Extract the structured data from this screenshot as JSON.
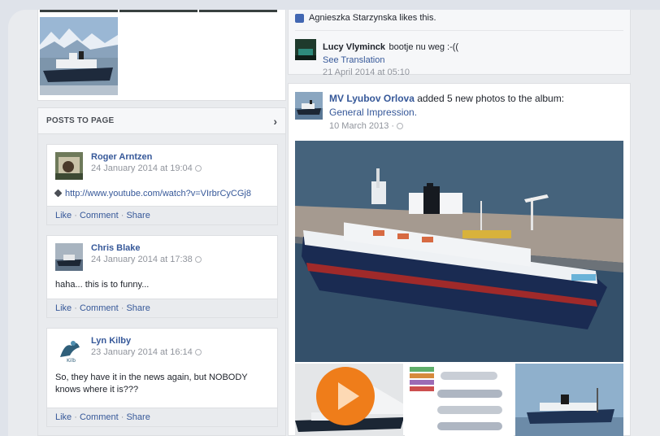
{
  "left": {
    "posts_to_page": {
      "title": "POSTS TO PAGE",
      "chevron": "chevron-right-icon",
      "posts": [
        {
          "author": "Roger Arntzen",
          "date": "24 January 2014 at 19:04",
          "link": "http://www.youtube.com/watch?v=VIrbrCyCGj8",
          "actions": {
            "like": "Like",
            "comment": "Comment",
            "share": "Share"
          }
        },
        {
          "author": "Chris Blake",
          "date": "24 January 2014 at 17:38",
          "text": "haha... this is to funny...",
          "actions": {
            "like": "Like",
            "comment": "Comment",
            "share": "Share"
          }
        },
        {
          "author": "Lyn Kilby",
          "date": "23 January 2014 at 16:14",
          "text": "So, they have it in the news again, but NOBODY knows where it is???",
          "actions": {
            "like": "Like",
            "comment": "Comment",
            "share": "Share"
          }
        }
      ]
    }
  },
  "right": {
    "likes_text": "Agnieszka Starzynska likes this.",
    "comment": {
      "author": "Lucy Vlyminck",
      "text": "bootje nu weg :-((",
      "see_translation": "See Translation",
      "date": "21 April 2014 at 05:10"
    },
    "feed_post": {
      "author": "MV Lyubov Orlova",
      "action": "added 5 new photos to the album:",
      "album": "General Impression.",
      "date": "10 March 2013 ·"
    }
  },
  "separator": "·",
  "colors": {
    "link": "#365899",
    "play": "#ef7d1a",
    "bg": "#e9ebee"
  }
}
